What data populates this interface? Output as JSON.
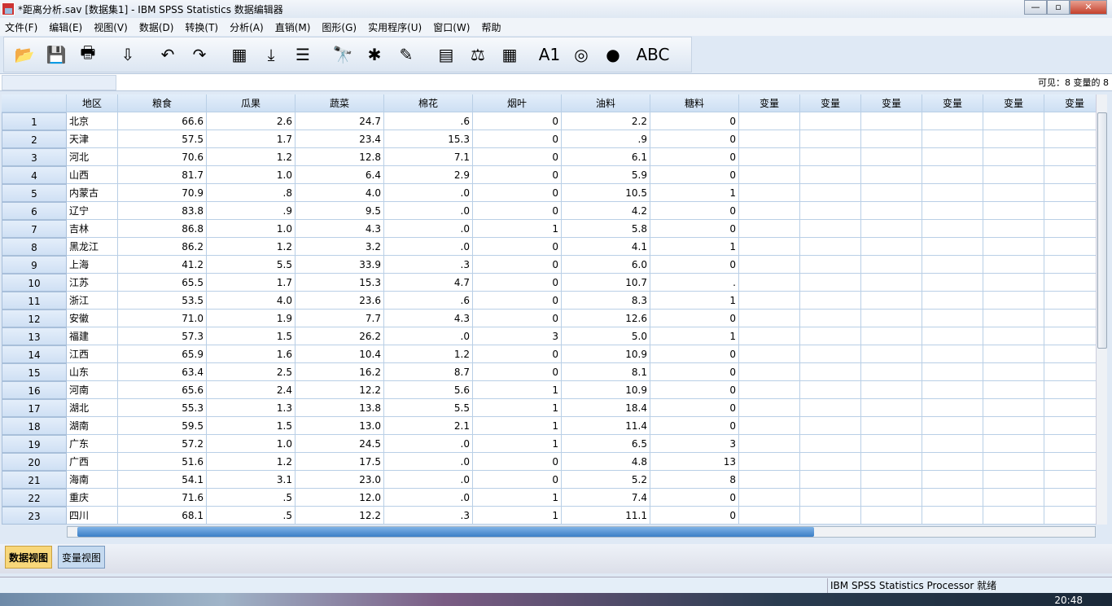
{
  "window": {
    "title": "*距离分析.sav [数据集1] - IBM SPSS Statistics 数据编辑器",
    "min": "—",
    "max": "▫",
    "close": "✕"
  },
  "menu": [
    "文件(F)",
    "编辑(E)",
    "视图(V)",
    "数据(D)",
    "转换(T)",
    "分析(A)",
    "直销(M)",
    "图形(G)",
    "实用程序(U)",
    "窗口(W)",
    "帮助"
  ],
  "toolbar": [
    {
      "icon": "open-folder-icon",
      "g": "📂"
    },
    {
      "icon": "save-icon",
      "g": "💾"
    },
    {
      "icon": "print-icon",
      "g": "🖶"
    },
    {
      "icon": "dialog-recall-icon",
      "g": "⇩"
    },
    {
      "icon": "undo-icon",
      "g": "↶"
    },
    {
      "icon": "redo-icon",
      "g": "↷"
    },
    {
      "icon": "goto-case-icon",
      "g": "▦"
    },
    {
      "icon": "goto-variable-icon",
      "g": "⤓"
    },
    {
      "icon": "variables-icon",
      "g": "☰"
    },
    {
      "icon": "find-icon",
      "g": "🔭"
    },
    {
      "icon": "insert-cases-icon",
      "g": "✱"
    },
    {
      "icon": "insert-variable-icon",
      "g": "✎"
    },
    {
      "icon": "split-file-icon",
      "g": "▤"
    },
    {
      "icon": "weight-cases-icon",
      "g": "⚖"
    },
    {
      "icon": "select-cases-icon",
      "g": "▦"
    },
    {
      "icon": "value-labels-icon",
      "g": "A1"
    },
    {
      "icon": "use-variable-sets-icon",
      "g": "◎"
    },
    {
      "icon": "show-all-variables-icon",
      "g": "●"
    },
    {
      "icon": "spell-check-icon",
      "g": "ABC"
    }
  ],
  "visible_label": "可见：8 变量的 8",
  "columns": [
    "地区",
    "粮食",
    "瓜果",
    "蔬菜",
    "棉花",
    "烟叶",
    "油料",
    "糖料"
  ],
  "empty_col_label": "变量",
  "rows": [
    [
      "1",
      "北京",
      "66.6",
      "2.6",
      "24.7",
      ".6",
      "0",
      "2.2",
      "0"
    ],
    [
      "2",
      "天津",
      "57.5",
      "1.7",
      "23.4",
      "15.3",
      "0",
      ".9",
      "0"
    ],
    [
      "3",
      "河北",
      "70.6",
      "1.2",
      "12.8",
      "7.1",
      "0",
      "6.1",
      "0"
    ],
    [
      "4",
      "山西",
      "81.7",
      "1.0",
      "6.4",
      "2.9",
      "0",
      "5.9",
      "0"
    ],
    [
      "5",
      "内蒙古",
      "70.9",
      ".8",
      "4.0",
      ".0",
      "0",
      "10.5",
      "1"
    ],
    [
      "6",
      "辽宁",
      "83.8",
      ".9",
      "9.5",
      ".0",
      "0",
      "4.2",
      "0"
    ],
    [
      "7",
      "吉林",
      "86.8",
      "1.0",
      "4.3",
      ".0",
      "1",
      "5.8",
      "0"
    ],
    [
      "8",
      "黑龙江",
      "86.2",
      "1.2",
      "3.2",
      ".0",
      "0",
      "4.1",
      "1"
    ],
    [
      "9",
      "上海",
      "41.2",
      "5.5",
      "33.9",
      ".3",
      "0",
      "6.0",
      "0"
    ],
    [
      "10",
      "江苏",
      "65.5",
      "1.7",
      "15.3",
      "4.7",
      "0",
      "10.7",
      "."
    ],
    [
      "11",
      "浙江",
      "53.5",
      "4.0",
      "23.6",
      ".6",
      "0",
      "8.3",
      "1"
    ],
    [
      "12",
      "安徽",
      "71.0",
      "1.9",
      "7.7",
      "4.3",
      "0",
      "12.6",
      "0"
    ],
    [
      "13",
      "福建",
      "57.3",
      "1.5",
      "26.2",
      ".0",
      "3",
      "5.0",
      "1"
    ],
    [
      "14",
      "江西",
      "65.9",
      "1.6",
      "10.4",
      "1.2",
      "0",
      "10.9",
      "0"
    ],
    [
      "15",
      "山东",
      "63.4",
      "2.5",
      "16.2",
      "8.7",
      "0",
      "8.1",
      "0"
    ],
    [
      "16",
      "河南",
      "65.6",
      "2.4",
      "12.2",
      "5.6",
      "1",
      "10.9",
      "0"
    ],
    [
      "17",
      "湖北",
      "55.3",
      "1.3",
      "13.8",
      "5.5",
      "1",
      "18.4",
      "0"
    ],
    [
      "18",
      "湖南",
      "59.5",
      "1.5",
      "13.0",
      "2.1",
      "1",
      "11.4",
      "0"
    ],
    [
      "19",
      "广东",
      "57.2",
      "1.0",
      "24.5",
      ".0",
      "1",
      "6.5",
      "3"
    ],
    [
      "20",
      "广西",
      "51.6",
      "1.2",
      "17.5",
      ".0",
      "0",
      "4.8",
      "13"
    ],
    [
      "21",
      "海南",
      "54.1",
      "3.1",
      "23.0",
      ".0",
      "0",
      "5.2",
      "8"
    ],
    [
      "22",
      "重庆",
      "71.6",
      ".5",
      "12.0",
      ".0",
      "1",
      "7.4",
      "0"
    ],
    [
      "23",
      "四川",
      "68.1",
      ".5",
      "12.2",
      ".3",
      "1",
      "11.1",
      "0"
    ]
  ],
  "tabs": {
    "data_view": "数据视图",
    "variable_view": "变量视图"
  },
  "status": "IBM SPSS Statistics Processor 就绪",
  "clock": "20:48"
}
